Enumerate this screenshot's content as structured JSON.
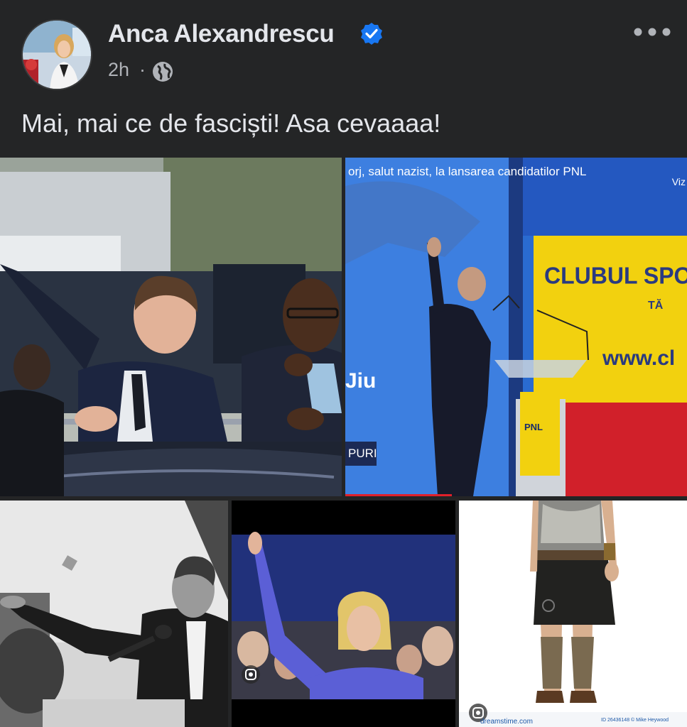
{
  "post": {
    "author_name": "Anca Alexandrescu",
    "verified_icon": "verified-badge-icon",
    "timestamp": "2h",
    "separator": "·",
    "audience_icon": "globe-icon",
    "more_icon": "more-options-icon",
    "text": "Mai, mai ce de fasciști! Asa cevaaaa!"
  },
  "photos": {
    "photo_2": {
      "caption": "orj, salut nazist, la lansarea candidatilor PNL",
      "corner_text": "Viz",
      "left_text": "Jiu",
      "lower_third": "PURI",
      "banner_line1": "CLUBUL SPO",
      "banner_line2": "TĂ",
      "banner_url": "www.cl",
      "podium_logo": "PNL"
    },
    "photo_4": {
      "lens_icon": "google-lens-icon"
    },
    "photo_5": {
      "lens_icon": "google-lens-icon",
      "watermark": "dreamstime.com",
      "stock_id": "ID 26436148 © Mike Heywood"
    }
  },
  "colors": {
    "background": "#242526",
    "text_primary": "#e4e6eb",
    "text_secondary": "#b0b3b8",
    "verified_blue": "#1877f2"
  }
}
